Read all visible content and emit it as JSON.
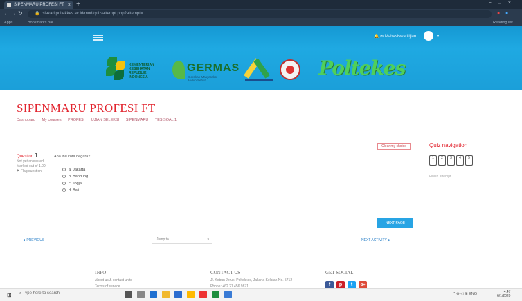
{
  "browser": {
    "tab_title": "SIPENMARU PROFESI FT",
    "new_tab": "+",
    "window_controls": [
      "−",
      "□",
      "×"
    ],
    "url": "siakad.poltekkes.ac.id/mod/quiz/attempt.php?attempt=...",
    "bookmarks": [
      "Apps",
      "Bookmarks bar"
    ],
    "reading_list": "Reading list"
  },
  "moodle": {
    "user_name": "Mahasiswa Ujian",
    "user_caret": "▾"
  },
  "banner": {
    "kemenkes_text": "KEMENTERIAN\nKESEHATAN\nREPUBLIK\nINDONESIA",
    "germas_text": "GERMAS",
    "germas_sub": "Gerakan Masyarakat\nHidup Sehat",
    "poltekes_text": "Poltekes"
  },
  "page": {
    "title": "SIPENMARU PROFESI FT",
    "breadcrumbs": [
      "Dashboard",
      "My courses",
      "PROFESI",
      "UJIAN SELEKSI",
      "SIPENMARU",
      "TES SOAL 1"
    ]
  },
  "question": {
    "label": "Question",
    "number": "1",
    "status": "Not yet answered",
    "marks": "Marked out of 1.00",
    "flag": "Flag question",
    "text": "Apa ibu kota negara?",
    "options": [
      {
        "letter": "a.",
        "text": "Jakarta"
      },
      {
        "letter": "b.",
        "text": "Bandung"
      },
      {
        "letter": "c.",
        "text": "Jogja"
      },
      {
        "letter": "d.",
        "text": "Bali"
      }
    ]
  },
  "quiz_nav": {
    "title": "Quiz navigation",
    "finish_link": "Finish attempt ...",
    "clear_choice": "Clear my choice",
    "boxes": [
      "1",
      "2",
      "3",
      "4",
      "5"
    ],
    "next_page": "NEXT PAGE",
    "previous": "◄ PREVIOUS",
    "jump_to": "Jump to...",
    "next_activity": "NEXT ACTIVITY ►"
  },
  "footer": {
    "info_title": "INFO",
    "info_lines": [
      "About us & contact units",
      "Terms of service"
    ],
    "contact_title": "CONTACT US",
    "contact_lines": [
      "Jl. Kebun Jeruk, Poltekkes, Jakarta Selatan No. 5712",
      "Phone: +62 21 456 9871"
    ],
    "social_title": "GET SOCIAL",
    "social": [
      {
        "label": "f",
        "color": "#3b5998"
      },
      {
        "label": "p",
        "color": "#cb2027"
      },
      {
        "label": "t",
        "color": "#1da1f2"
      },
      {
        "label": "G+",
        "color": "#dd4b39"
      }
    ]
  },
  "taskbar": {
    "start": "⊞",
    "search_placeholder": "Type here to search",
    "tray": "^ ⊕ ◁ ⊞ ENG",
    "time": "4:47",
    "date": "6/1/2020"
  },
  "colors": {
    "accent_red": "#e2252f",
    "moodle_blue": "#1598d3",
    "link_blue": "#2b80c8"
  }
}
